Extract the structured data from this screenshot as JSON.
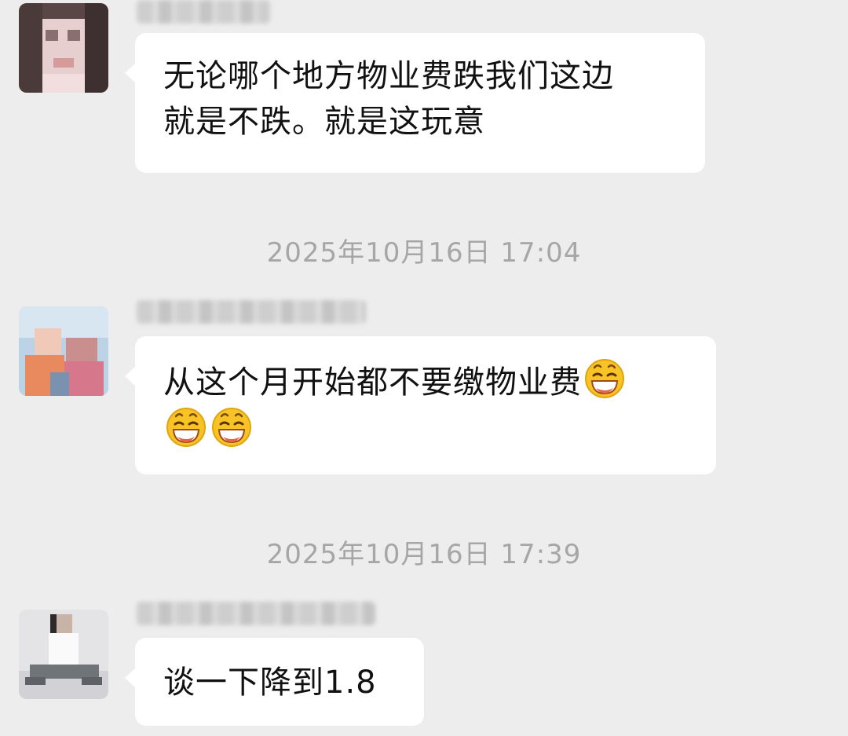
{
  "messages": [
    {
      "avatar_icon": "blurred-face-avatar",
      "text_lines": [
        "无论哪个地方物业费跌我们这边",
        "就是不跌。就是这玩意"
      ]
    },
    {
      "avatar_icon": "blurred-group-photo-avatar",
      "text_lines": [
        "从这个月开始都不要缴物业费"
      ],
      "emoji_icon": "grinning-face-emoji",
      "emoji_count": 3
    },
    {
      "avatar_icon": "sitting-person-avatar",
      "text_lines": [
        "谈一下降到1.8"
      ]
    }
  ],
  "timestamps": [
    "2025年10月16日 17:04",
    "2025年10月16日 17:39"
  ],
  "colors": {
    "background": "#ededed",
    "bubble": "#ffffff",
    "timestamp": "#a6a6a6",
    "text": "#111111"
  }
}
